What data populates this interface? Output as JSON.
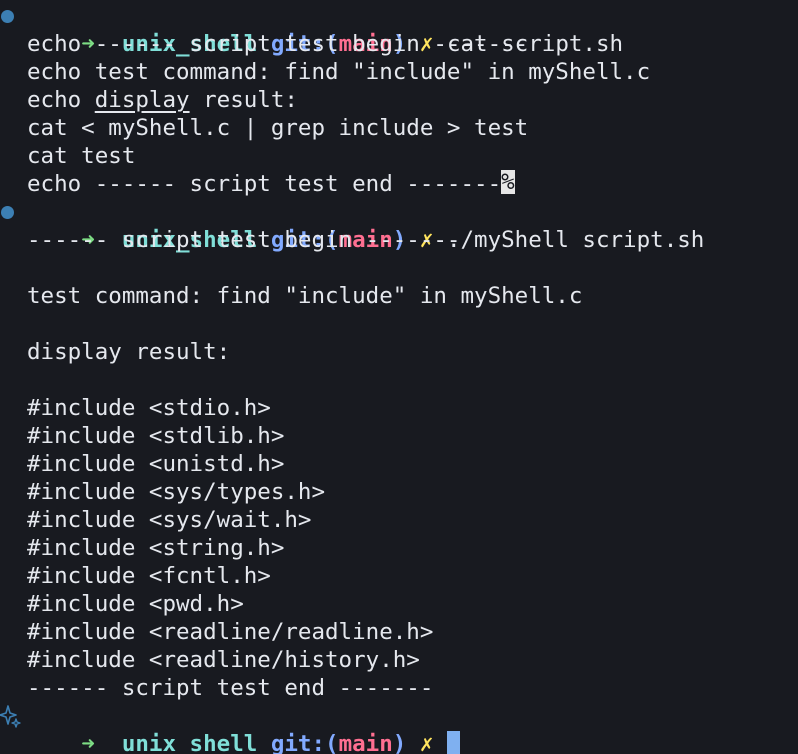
{
  "prompt": {
    "arrow": "➜",
    "directory": "unix_shell",
    "git_label": "git:(",
    "branch": "main",
    "git_close": ")",
    "dirty_mark": "✗"
  },
  "commands": [
    "cat script.sh",
    "./myShell script.sh"
  ],
  "script_file": {
    "lines": [
      "echo ------ script test begin -------",
      "echo test command: find \"include\" in myShell.c",
      "echo ",
      "display",
      " result:",
      "cat < myShell.c | grep include > test",
      "cat test",
      "echo ------ script test end -------"
    ],
    "no_newline_marker": "%"
  },
  "output": {
    "begin": "------ script test begin -------",
    "test_command": "test command: find \"include\" in myShell.c",
    "display": "display result:",
    "includes": [
      "#include <stdio.h>",
      "#include <stdlib.h>",
      "#include <unistd.h>",
      "#include <sys/types.h>",
      "#include <sys/wait.h>",
      "#include <string.h>",
      "#include <fcntl.h>",
      "#include <pwd.h>",
      "#include <readline/readline.h>",
      "#include <readline/history.h>"
    ],
    "end": "------ script test end -------"
  },
  "colors": {
    "background": "#181a20",
    "text": "#e5e8ee",
    "arrow": "#7ddc84",
    "directory": "#80dfd8",
    "git": "#82aaff",
    "branch": "#ff6f91",
    "dirty": "#ffe45e",
    "cursor": "#7fb0f0",
    "marker": "#3c7fb3"
  },
  "icons": {
    "command_marker": "circle-marker-icon",
    "prompt_marker": "sparkle-icon"
  }
}
